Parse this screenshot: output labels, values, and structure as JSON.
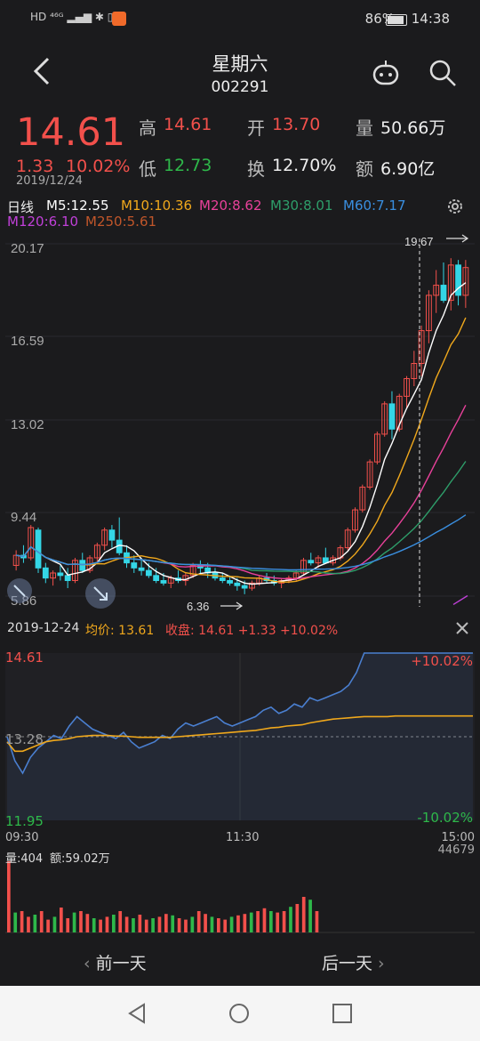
{
  "status_bar": {
    "left_icons": "HD ⁴⁶ᴳ ▂▄▆ ✱ ▯",
    "battery": "86%",
    "time": "14:38"
  },
  "header": {
    "title": "星期六",
    "code": "002291"
  },
  "quote": {
    "price": "14.61",
    "change": "1.33",
    "change_pct": "10.02%",
    "date": "2019/12/24",
    "high_label": "高",
    "high": "14.61",
    "low_label": "低",
    "low": "12.73",
    "open_label": "开",
    "open": "13.70",
    "turnover_label": "换",
    "turnover": "12.70%",
    "volume_label": "量",
    "volume": "50.66万",
    "amount_label": "额",
    "amount": "6.90亿"
  },
  "ma_bar": {
    "period": "日线",
    "m5": "M5:12.55",
    "m10": "M10:10.36",
    "m20": "M20:8.62",
    "m30": "M30:8.01",
    "m60": "M60:7.17",
    "m120": "M120:6.10",
    "m250": "M250:5.61"
  },
  "colors": {
    "up": "#f2504b",
    "down": "#34d6e6",
    "m5": "#ffffff",
    "m10": "#f0a81c",
    "m20": "#e8419a",
    "m30": "#2e9e6a",
    "m60": "#3a8fe0",
    "m120": "#c040d8",
    "m250": "#c0562a",
    "avg": "#f0a81c",
    "price_line": "#4a7fd0"
  },
  "chart_data": [
    {
      "type": "candlestick",
      "y_tick_labels": [
        "20.17",
        "16.59",
        "13.02",
        "9.44",
        "5.86"
      ],
      "ylim": [
        5.86,
        20.17
      ],
      "annotations": {
        "high_mark": "19.67",
        "low_mark": "6.36"
      },
      "candles": [
        [
          7.5,
          8.1,
          7.3,
          7.9
        ],
        [
          7.9,
          8.3,
          7.6,
          7.8
        ],
        [
          7.8,
          9.1,
          7.7,
          9.0
        ],
        [
          8.9,
          9.0,
          7.2,
          7.4
        ],
        [
          7.4,
          7.6,
          6.8,
          7.0
        ],
        [
          7.0,
          7.3,
          6.7,
          7.2
        ],
        [
          7.2,
          7.5,
          6.9,
          7.1
        ],
        [
          7.1,
          7.4,
          6.6,
          6.9
        ],
        [
          6.9,
          7.8,
          6.8,
          7.7
        ],
        [
          7.7,
          8.0,
          7.2,
          7.3
        ],
        [
          7.3,
          7.9,
          7.2,
          7.8
        ],
        [
          7.8,
          8.4,
          7.6,
          8.3
        ],
        [
          8.3,
          9.0,
          8.1,
          8.9
        ],
        [
          8.9,
          9.1,
          8.2,
          8.5
        ],
        [
          8.5,
          9.4,
          7.9,
          8.0
        ],
        [
          8.0,
          8.3,
          7.4,
          7.6
        ],
        [
          7.6,
          7.9,
          7.2,
          7.4
        ],
        [
          7.4,
          7.8,
          7.1,
          7.3
        ],
        [
          7.3,
          7.6,
          7.0,
          7.1
        ],
        [
          7.1,
          7.4,
          6.8,
          6.9
        ],
        [
          6.9,
          7.2,
          6.7,
          6.8
        ],
        [
          6.8,
          7.1,
          6.6,
          7.0
        ],
        [
          7.0,
          7.3,
          6.8,
          6.9
        ],
        [
          6.9,
          7.2,
          6.7,
          7.1
        ],
        [
          7.1,
          7.6,
          7.0,
          7.5
        ],
        [
          7.5,
          7.7,
          7.2,
          7.4
        ],
        [
          7.4,
          7.6,
          7.0,
          7.2
        ],
        [
          7.2,
          7.4,
          6.9,
          7.0
        ],
        [
          7.0,
          7.2,
          6.8,
          6.9
        ],
        [
          6.9,
          7.1,
          6.7,
          6.8
        ],
        [
          6.8,
          7.0,
          6.5,
          6.7
        ],
        [
          6.7,
          6.9,
          6.36,
          6.6
        ],
        [
          6.6,
          6.9,
          6.5,
          6.8
        ],
        [
          6.8,
          7.1,
          6.7,
          7.0
        ],
        [
          7.0,
          7.2,
          6.8,
          6.9
        ],
        [
          6.9,
          7.1,
          6.7,
          6.8
        ],
        [
          6.8,
          7.0,
          6.6,
          6.9
        ],
        [
          6.9,
          7.1,
          6.8,
          7.0
        ],
        [
          7.0,
          7.3,
          6.9,
          7.2
        ],
        [
          7.2,
          7.8,
          7.1,
          7.7
        ],
        [
          7.7,
          8.0,
          7.5,
          7.6
        ],
        [
          7.6,
          7.9,
          7.4,
          7.8
        ],
        [
          7.8,
          8.2,
          7.6,
          7.6
        ],
        [
          7.6,
          7.9,
          7.5,
          7.8
        ],
        [
          7.8,
          8.3,
          7.7,
          8.2
        ],
        [
          8.2,
          9.0,
          8.1,
          8.9
        ],
        [
          8.9,
          9.8,
          8.8,
          9.7
        ],
        [
          9.7,
          10.7,
          9.6,
          10.6
        ],
        [
          10.6,
          11.7,
          10.5,
          11.6
        ],
        [
          11.6,
          12.8,
          11.5,
          12.7
        ],
        [
          12.7,
          14.0,
          12.6,
          13.9
        ],
        [
          13.9,
          14.4,
          12.5,
          12.9
        ],
        [
          12.9,
          14.3,
          12.8,
          14.2
        ],
        [
          14.2,
          15.0,
          13.7,
          14.9
        ],
        [
          14.9,
          16.0,
          14.6,
          15.5
        ],
        [
          15.5,
          17.0,
          15.0,
          16.8
        ],
        [
          16.8,
          18.4,
          16.3,
          18.2
        ],
        [
          18.2,
          19.2,
          17.5,
          18.6
        ],
        [
          18.6,
          19.5,
          17.9,
          18.0
        ],
        [
          18.0,
          19.67,
          17.6,
          19.4
        ],
        [
          19.4,
          19.6,
          17.8,
          18.2
        ],
        [
          18.2,
          19.6,
          17.7,
          19.3
        ]
      ]
    },
    {
      "type": "line",
      "date": "2019-12-24",
      "avg_label": "均价: 13.61",
      "close_label": "收盘: 14.61 +1.33 +10.02%",
      "y_top": "14.61",
      "y_mid": "13.28",
      "y_bottom": "11.95",
      "pct_top": "+10.02%",
      "pct_bottom": "-10.02%",
      "x_labels": [
        "09:30",
        "11:30",
        "15:00"
      ],
      "ylim": [
        11.95,
        14.61
      ],
      "price": [
        13.28,
        12.9,
        12.7,
        12.95,
        13.1,
        13.2,
        13.3,
        13.25,
        13.45,
        13.6,
        13.5,
        13.4,
        13.35,
        13.3,
        13.25,
        13.35,
        13.2,
        13.1,
        13.15,
        13.2,
        13.3,
        13.25,
        13.4,
        13.5,
        13.45,
        13.5,
        13.55,
        13.6,
        13.5,
        13.45,
        13.5,
        13.55,
        13.6,
        13.7,
        13.75,
        13.65,
        13.7,
        13.8,
        13.75,
        13.9,
        13.85,
        13.9,
        13.95,
        14.0,
        14.1,
        14.3,
        14.61,
        14.61,
        14.61,
        14.61,
        14.61,
        14.61,
        14.61,
        14.61,
        14.61,
        14.61,
        14.61,
        14.61,
        14.61,
        14.61,
        14.61
      ],
      "avg": [
        13.2,
        13.05,
        13.05,
        13.1,
        13.15,
        13.2,
        13.22,
        13.23,
        13.25,
        13.28,
        13.29,
        13.3,
        13.3,
        13.3,
        13.29,
        13.29,
        13.28,
        13.27,
        13.27,
        13.27,
        13.27,
        13.27,
        13.28,
        13.29,
        13.3,
        13.31,
        13.32,
        13.33,
        13.34,
        13.35,
        13.36,
        13.37,
        13.38,
        13.4,
        13.42,
        13.43,
        13.45,
        13.46,
        13.47,
        13.5,
        13.52,
        13.54,
        13.56,
        13.57,
        13.58,
        13.59,
        13.6,
        13.6,
        13.6,
        13.6,
        13.61,
        13.61,
        13.61,
        13.61,
        13.61,
        13.61,
        13.61,
        13.61,
        13.61,
        13.61,
        13.61
      ]
    },
    {
      "type": "bar",
      "label_volume": "量:404",
      "label_amount": "额:59.02万",
      "max_label": "44679"
    }
  ],
  "bottom_nav": {
    "prev": "前一天",
    "next": "后一天"
  }
}
